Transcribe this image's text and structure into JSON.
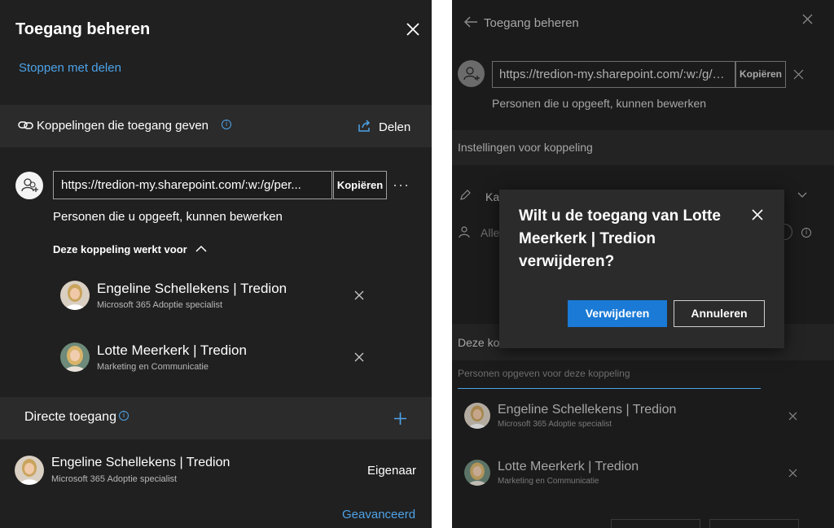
{
  "left_panel": {
    "title": "Toegang beheren",
    "stop_sharing": "Stoppen met delen",
    "links_label": "Koppelingen die toegang geven",
    "share_label": "Delen",
    "link_url": "https://tredion-my.sharepoint.com/:w:/g/per...",
    "copy_label": "Kopiëren",
    "more_label": "···",
    "permission_text": "Personen die u opgeeft, kunnen bewerken",
    "works_for_label": "Deze koppeling werkt voor",
    "link_people": [
      {
        "name": "Engeline Schellekens | Tredion",
        "role": "Microsoft 365 Adoptie specialist"
      },
      {
        "name": "Lotte Meerkerk | Tredion",
        "role": "Marketing en Communicatie"
      }
    ],
    "direct_access_label": "Directe toegang",
    "owner": {
      "name": "Engeline Schellekens | Tredion",
      "role": "Microsoft 365 Adoptie specialist",
      "access": "Eigenaar"
    },
    "advanced_label": "Geavanceerd"
  },
  "right_panel": {
    "title": "Toegang beheren",
    "link_url": "https://tredion-my.sharepoint.com/:w:/g/p...",
    "copy_label": "Kopiëren",
    "permission_text": "Personen die u opgeeft, kunnen bewerken",
    "settings_label": "Instellingen voor koppeling",
    "edit_truncated": "Ka",
    "allow_truncated": "Alle",
    "link_for_truncated": "Deze ko",
    "add_people_placeholder": "Personen opgeven voor deze koppeling",
    "link_people": [
      {
        "name": "Engeline Schellekens | Tredion",
        "role": "Microsoft 365 Adoptie specialist"
      },
      {
        "name": "Lotte Meerkerk | Tredion",
        "role": "Marketing en Communicatie"
      }
    ]
  },
  "dialog": {
    "title": "Wilt u de toegang van Lotte Meerkerk | Tredion verwijderen?",
    "primary_label": "Verwijderen",
    "secondary_label": "Annuleren"
  },
  "colors": {
    "accent": "#4da3e8",
    "primary_button": "#1a7ad6",
    "left_background": "#202020",
    "right_background": "#1b1b1b"
  }
}
